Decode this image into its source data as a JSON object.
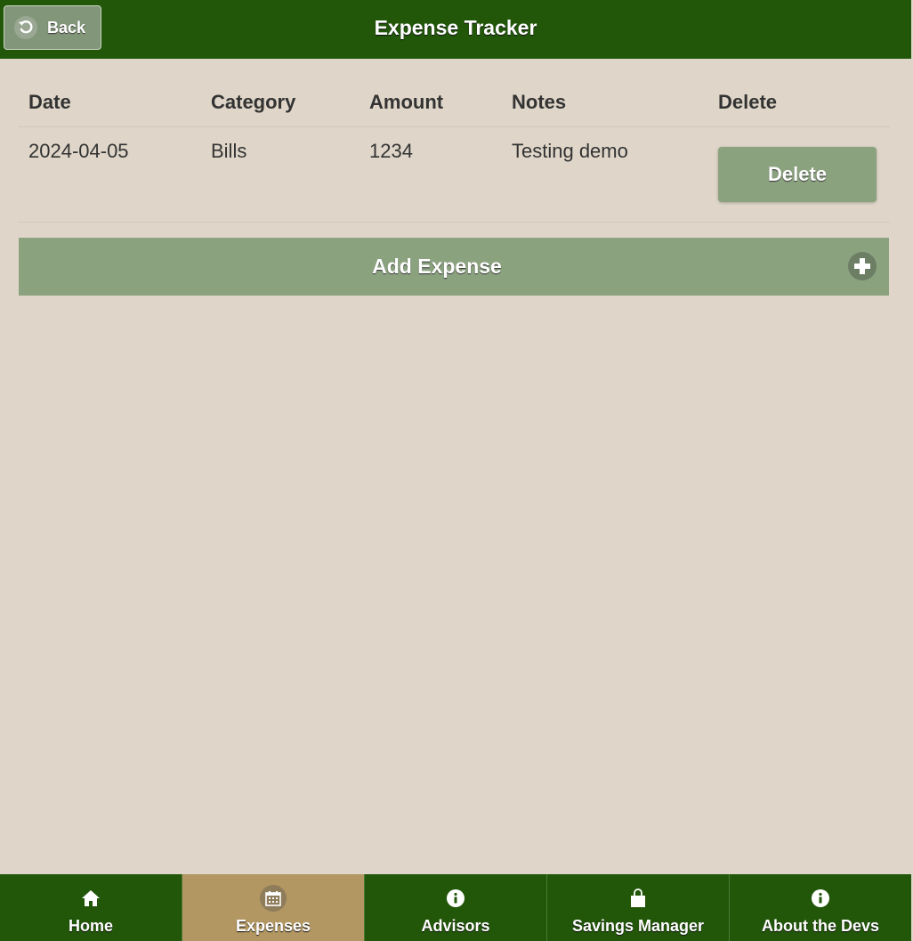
{
  "header": {
    "back_label": "Back",
    "title": "Expense Tracker"
  },
  "table": {
    "columns": [
      "Date",
      "Category",
      "Amount",
      "Notes",
      "Delete"
    ],
    "rows": [
      {
        "date": "2024-04-05",
        "category": "Bills",
        "amount": "1234",
        "notes": "Testing demo",
        "delete_label": "Delete"
      }
    ]
  },
  "add_expense": {
    "label": "Add Expense",
    "icon": "plus-icon"
  },
  "navbar": {
    "items": [
      {
        "label": "Home",
        "icon": "home-icon",
        "active": false
      },
      {
        "label": "Expenses",
        "icon": "calendar-icon",
        "active": true
      },
      {
        "label": "Advisors",
        "icon": "info-icon",
        "active": false
      },
      {
        "label": "Savings Manager",
        "icon": "shopping-bag-icon",
        "active": false
      },
      {
        "label": "About the Devs",
        "icon": "info-icon",
        "active": false
      }
    ]
  },
  "colors": {
    "header_bg": "#22570a",
    "page_bg": "#dfd6c9",
    "button_bg": "#8ba27f",
    "active_tab_bg": "#b29762"
  }
}
